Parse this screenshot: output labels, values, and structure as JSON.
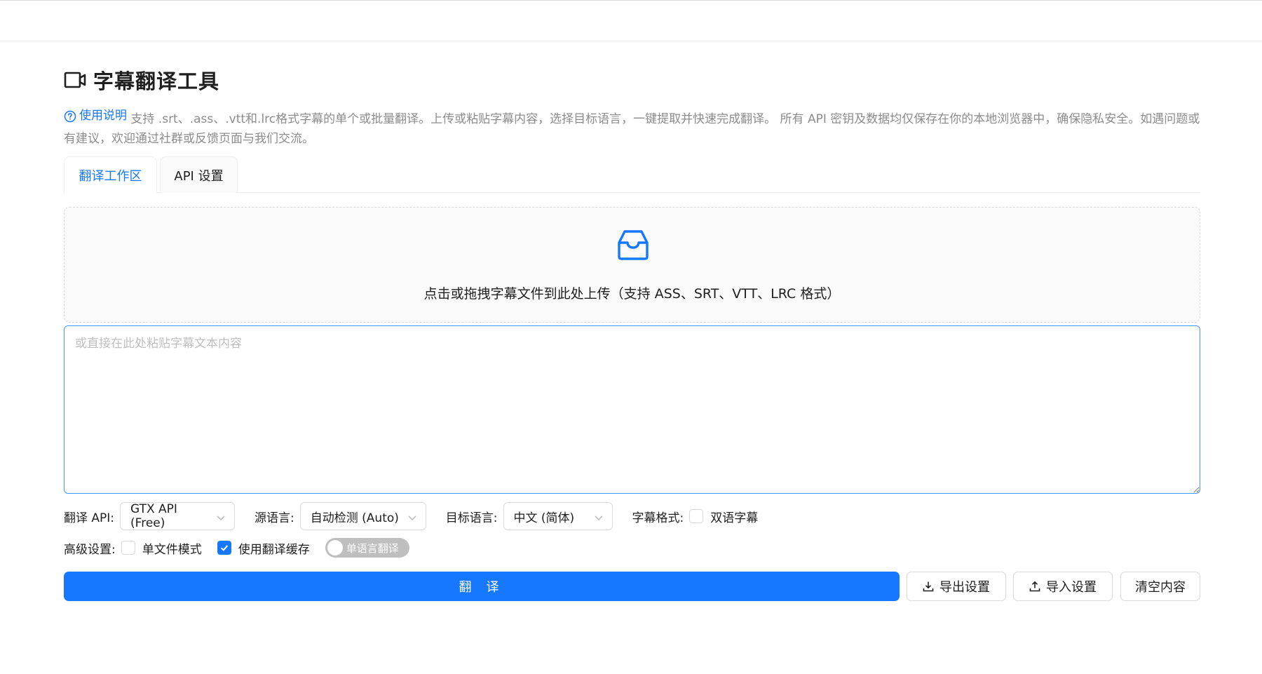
{
  "header": {
    "title": "字幕翻译工具",
    "title_icon": "video-camera-icon"
  },
  "description": {
    "help_link": "使用说明",
    "text": " 支持 .srt、.ass、.vtt和.lrc格式字幕的单个或批量翻译。上传或粘贴字幕内容，选择目标语言，一键提取并快速完成翻译。 所有 API 密钥及数据均仅保存在你的本地浏览器中，确保隐私安全。如遇问题或有建议，欢迎通过社群或反馈页面与我们交流。"
  },
  "tabs": [
    {
      "label": "翻译工作区",
      "active": true
    },
    {
      "label": "API 设置",
      "active": false
    }
  ],
  "upload": {
    "icon": "inbox-icon",
    "text": "点击或拖拽字幕文件到此处上传（支持 ASS、SRT、VTT、LRC 格式）"
  },
  "paste": {
    "placeholder": "或直接在此处粘贴字幕文本内容",
    "value": ""
  },
  "options": {
    "api_label": "翻译 API:",
    "api_value": "GTX API (Free)",
    "source_label": "源语言:",
    "source_value": "自动检测 (Auto)",
    "target_label": "目标语言:",
    "target_value": "中文 (简体)",
    "format_label": "字幕格式:",
    "bilingual_label": "双语字幕",
    "bilingual_checked": false
  },
  "advanced": {
    "label": "高级设置:",
    "single_file_label": "单文件模式",
    "single_file_checked": false,
    "cache_label": "使用翻译缓存",
    "cache_checked": true,
    "toggle_label": "单语言翻译",
    "toggle_on": false
  },
  "actions": {
    "translate": "翻 译",
    "export": "导出设置",
    "import": "导入设置",
    "clear": "清空内容"
  },
  "colors": {
    "primary": "#1677ff",
    "border": "#d9d9d9",
    "muted_text": "#8c8c8c"
  }
}
